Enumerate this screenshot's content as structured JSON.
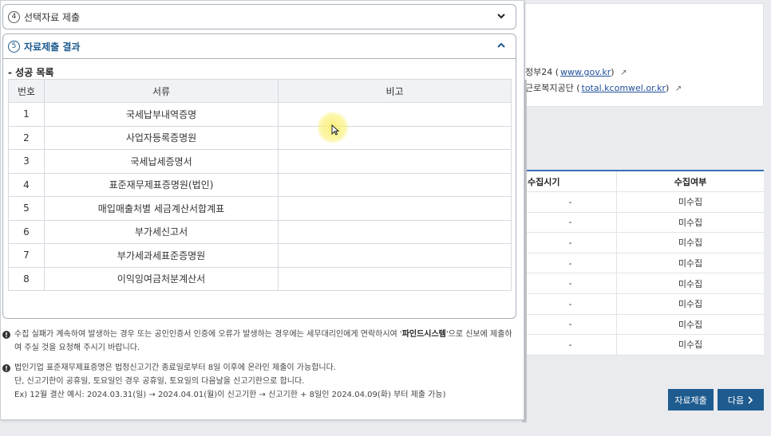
{
  "background": {
    "links": [
      {
        "prefix": "정부24 (",
        "link": "www.gov.kr",
        "suffix": ")"
      },
      {
        "prefix": "근로복지공단 (",
        "link": "total.kcomwel.or.kr",
        "suffix": ")"
      }
    ],
    "table": {
      "headers": [
        "수집시기",
        "수집여부"
      ],
      "rows": [
        [
          "-",
          "미수집"
        ],
        [
          "-",
          "미수집"
        ],
        [
          "-",
          "미수집"
        ],
        [
          "-",
          "미수집"
        ],
        [
          "-",
          "미수집"
        ],
        [
          "-",
          "미수집"
        ],
        [
          "-",
          "미수집"
        ],
        [
          "-",
          "미수집"
        ]
      ]
    },
    "buttons": {
      "submit": "자료제출",
      "next": "다음"
    }
  },
  "accordion": {
    "step4": {
      "num": "4",
      "title": "선택자료 제출"
    },
    "step5": {
      "num": "5",
      "title": "자료제출 결과"
    }
  },
  "results": {
    "section_label": "- 성공 목록",
    "headers": {
      "no": "번호",
      "doc": "서류",
      "note": "비고"
    },
    "rows": [
      {
        "no": "1",
        "doc": "국세납부내역증명",
        "note": ""
      },
      {
        "no": "2",
        "doc": "사업자등록증명원",
        "note": ""
      },
      {
        "no": "3",
        "doc": "국세납세증명서",
        "note": ""
      },
      {
        "no": "4",
        "doc": "표준재무제표증명원(법인)",
        "note": ""
      },
      {
        "no": "5",
        "doc": "매입매출처별 세금계산서합계표",
        "note": ""
      },
      {
        "no": "6",
        "doc": "부가세신고서",
        "note": ""
      },
      {
        "no": "7",
        "doc": "부가세과세표준증명원",
        "note": ""
      },
      {
        "no": "8",
        "doc": "이익잉여금처분계산서",
        "note": ""
      }
    ]
  },
  "notes": {
    "note1_a": "수집 실패가 계속하여 발생하는 경우 또는 공인인증서 인증에 오류가 발생하는 경우에는 세무대리인에게 연락하시여 '",
    "note1_b": "파인드시스템",
    "note1_c": "'으로 신보에 제출하여 주실 것을 요청해 주시기 바랍니다.",
    "note2_a": "법인기업 표준재무제표증명은 법정신고기간 종료일로부터 8일 이후에 온라인 제출이 가능합니다.",
    "note2_b": "단, 신고기한이 공휴일, 토요일인 경우 공휴일, 토요일의 다음날을 신고기한으로 합니다.",
    "note2_c": "Ex) 12월 결산 예시: 2024.03.31(일) → 2024.04.01(월)이 신고기한 → 신고기한 + 8일인 2024.04.09(화) 부터 제출 가능)"
  },
  "colors": {
    "accent": "#1e5b8f",
    "table_top": "#3b71b8",
    "highlight": "#faee64"
  },
  "icons": [
    "chevron-down-icon",
    "chevron-up-icon",
    "external-link-icon",
    "info-icon",
    "chevron-right-icon",
    "cursor-icon"
  ]
}
